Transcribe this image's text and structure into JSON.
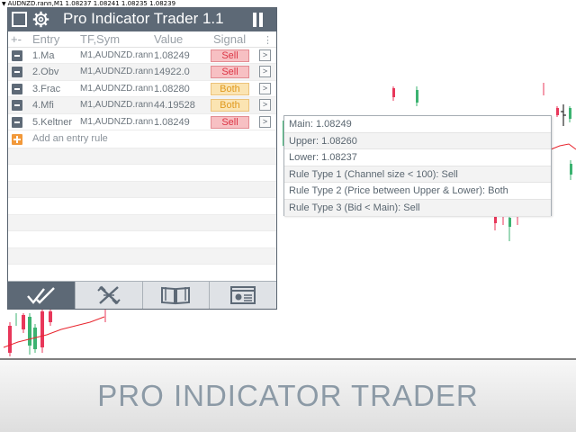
{
  "chart": {
    "header_text": "AUDNZD.rann,M1  1.08237 1.08241 1.08235 1.08239",
    "colors": {
      "bull": "#3cb371",
      "bear": "#e8375a",
      "ma": "#e8252e",
      "axis": "#000000"
    }
  },
  "panel": {
    "title": "Pro Indicator Trader 1.1",
    "icons": {
      "window": "window-icon",
      "settings": "gear-icon",
      "pause": "pause-icon"
    },
    "columns": {
      "plusminus": "+-",
      "entry": "Entry",
      "tfsym": "TF,Sym",
      "value": "Value",
      "signal": "Signal",
      "more": "⋮"
    },
    "rows": [
      {
        "entry": "1.Ma",
        "tfsym": "M1,AUDNZD.rann",
        "value": "1.08249",
        "signal": "Sell",
        "signal_type": "sell",
        "arrow": ">"
      },
      {
        "entry": "2.Obv",
        "tfsym": "M1,AUDNZD.rann",
        "value": "14922.0",
        "signal": "Sell",
        "signal_type": "sell",
        "arrow": ">"
      },
      {
        "entry": "3.Frac",
        "tfsym": "M1,AUDNZD.rann",
        "value": "1.08280",
        "signal": "Both",
        "signal_type": "both",
        "arrow": ">"
      },
      {
        "entry": "4.Mfi",
        "tfsym": "M1,AUDNZD.rann",
        "value": "44.19528",
        "signal": "Both",
        "signal_type": "both",
        "arrow": ">"
      },
      {
        "entry": "5.Keltner",
        "tfsym": "M1,AUDNZD.rann",
        "value": "1.08249",
        "signal": "Sell",
        "signal_type": "sell",
        "arrow": ">"
      }
    ],
    "add_entry_label": "Add an entry rule",
    "tabs": [
      {
        "name": "signals",
        "icon": "double-check-icon",
        "active": true
      },
      {
        "name": "tools",
        "icon": "crossed-tools-icon",
        "active": false
      },
      {
        "name": "manual",
        "icon": "open-book-icon",
        "active": false
      },
      {
        "name": "report",
        "icon": "presentation-icon",
        "active": false
      }
    ]
  },
  "tooltip": {
    "lines": [
      "Main: 1.08249",
      "Upper: 1.08260",
      "Lower: 1.08237",
      "Rule Type 1 (Channel size < 100): Sell",
      "Rule Type 2 (Price between Upper & Lower): Both",
      "Rule Type 3 (Bid < Main): Sell"
    ]
  },
  "banner": {
    "text": "PRO INDICATOR TRADER"
  }
}
